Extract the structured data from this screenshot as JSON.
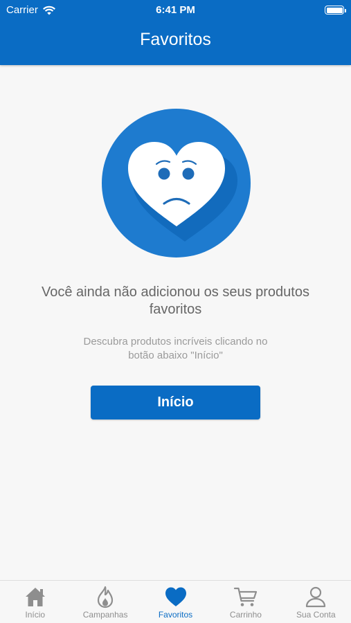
{
  "status_bar": {
    "carrier": "Carrier",
    "time": "6:41 PM"
  },
  "header": {
    "title": "Favoritos"
  },
  "empty_state": {
    "message": "Você ainda não adicionou os seus produtos favoritos",
    "submessage": "Descubra produtos incríveis clicando no botão abaixo \"Início\"",
    "button_label": "Início"
  },
  "tabbar": {
    "items": [
      {
        "label": "Início",
        "icon": "home-icon",
        "active": false
      },
      {
        "label": "Campanhas",
        "icon": "flame-icon",
        "active": false
      },
      {
        "label": "Favoritos",
        "icon": "heart-icon",
        "active": true
      },
      {
        "label": "Carrinho",
        "icon": "cart-icon",
        "active": false
      },
      {
        "label": "Sua Conta",
        "icon": "user-icon",
        "active": false
      }
    ]
  },
  "colors": {
    "primary": "#0a6cc4",
    "background": "#f7f7f7",
    "inactive": "#8e8e8e"
  }
}
